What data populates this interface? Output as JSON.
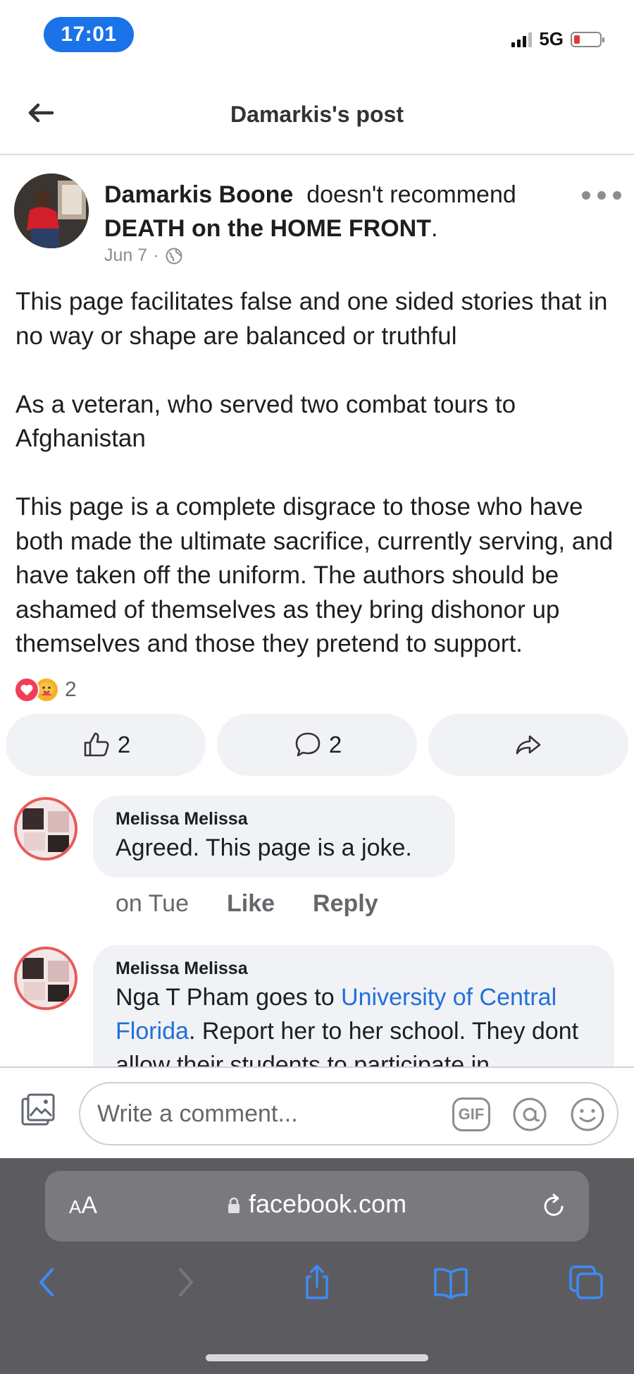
{
  "status_bar": {
    "time": "17:01",
    "network": "5G"
  },
  "header": {
    "title": "Damarkis's post"
  },
  "post": {
    "author": "Damarkis Boone",
    "action": "doesn't recommend",
    "page_name": "DEATH on the HOME FRONT",
    "date": "Jun 7",
    "body": [
      "This page facilitates false and one sided stories that in no way or shape are balanced or truthful",
      "As a veteran, who served two combat tours to Afghanistan",
      "This page is a complete disgrace to those who have both made the ultimate sacrifice, currently serving, and have taken off the uniform. The authors should be ashamed of themselves as they bring dishonor up themselves and those they pretend to support."
    ],
    "reaction_count": "2",
    "like_count": "2",
    "comment_count": "2"
  },
  "comments": [
    {
      "name": "Melissa Melissa",
      "text": "Agreed. This page is a joke.",
      "time": "on Tue",
      "like_label": "Like",
      "reply_label": "Reply"
    },
    {
      "name": "Melissa Melissa",
      "text_before": "Nga T Pham goes to ",
      "link": "University of Central Florida",
      "text_after": ". Report her to her school. They dont allow their students to participate in"
    }
  ],
  "composer": {
    "placeholder": "Write a comment...",
    "gif_label": "GIF"
  },
  "browser": {
    "aa_label": "A",
    "aa_large": "A",
    "url": "facebook.com"
  },
  "colors": {
    "brand_blue": "#1a73e8",
    "link": "#216fdb",
    "love": "#f33e58",
    "care": "#f7b125"
  }
}
